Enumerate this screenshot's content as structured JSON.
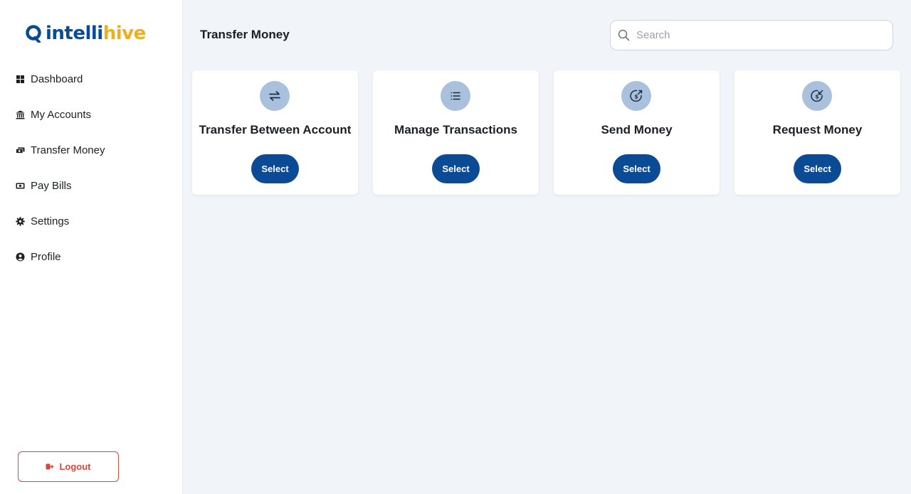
{
  "brand": {
    "name_part1": "intelli",
    "name_part2": "hive",
    "color_primary": "#0b4a95",
    "color_accent": "#f2ad1d"
  },
  "sidebar": {
    "items": [
      {
        "label": "Dashboard",
        "icon": "grid-icon"
      },
      {
        "label": "My Accounts",
        "icon": "bank-icon"
      },
      {
        "label": "Transfer Money",
        "icon": "money-transfer-icon"
      },
      {
        "label": "Pay Bills",
        "icon": "bill-icon"
      },
      {
        "label": "Settings",
        "icon": "gear-icon"
      },
      {
        "label": "Profile",
        "icon": "user-circle-icon"
      }
    ],
    "logout_label": "Logout"
  },
  "header": {
    "title": "Transfer Money",
    "search_placeholder": "Search"
  },
  "cards": [
    {
      "title": "Transfer Between Account",
      "button": "Select",
      "icon": "arrows-exchange-icon"
    },
    {
      "title": "Manage Transactions",
      "button": "Select",
      "icon": "list-icon"
    },
    {
      "title": "Send Money",
      "button": "Select",
      "icon": "send-money-icon"
    },
    {
      "title": "Request Money",
      "button": "Select",
      "icon": "request-money-icon"
    }
  ],
  "colors": {
    "button": "#0b4a95",
    "icon_circle": "#a9c1dc",
    "logout": "#d9463d"
  }
}
